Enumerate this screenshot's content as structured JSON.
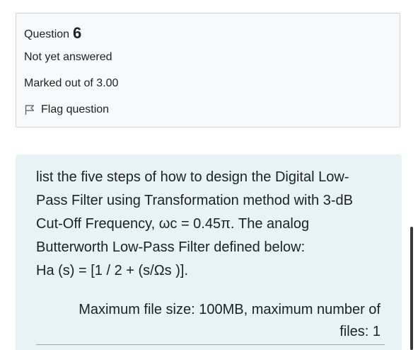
{
  "question_info": {
    "label": "Question",
    "number": "6",
    "state": "Not yet answered",
    "grade": "Marked out of 3.00",
    "flag_label": "Flag question",
    "flag_icon": "flag-icon"
  },
  "question_text": {
    "lines": [
      "list the five steps of how to design the Digital Low-",
      "Pass Filter using Transformation method with 3-dB",
      "Cut-Off Frequency, ωc = 0.45π. The analog",
      "Butterworth Low-Pass Filter defined below:",
      "Ha (s) = [1 / 2 + (s/Ωs )]."
    ]
  },
  "attachment": {
    "lines": [
      "Maximum file size: 100MB, maximum number of",
      "files: 1"
    ]
  },
  "colors": {
    "info_background": "#f8f9fa",
    "info_border": "#cfd2d6",
    "content_background": "#e7f3f5",
    "text": "#1d2125"
  }
}
